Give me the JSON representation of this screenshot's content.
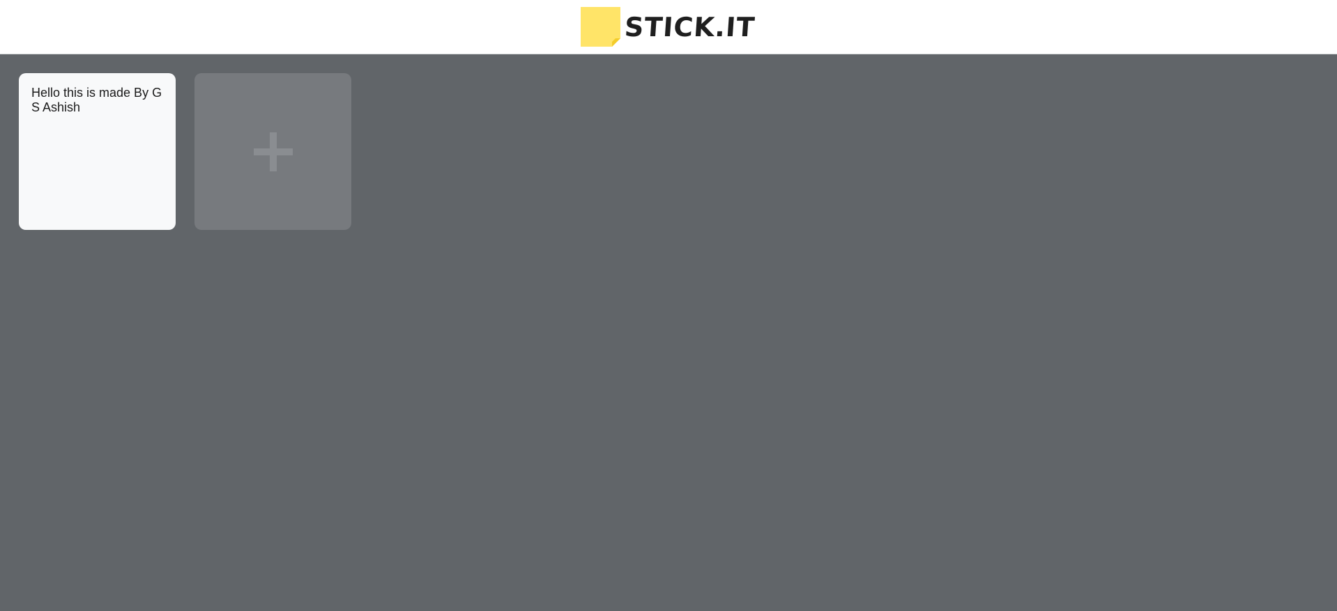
{
  "header": {
    "logo_text": "STICK.IT",
    "logo_color": "#ffe468"
  },
  "board": {
    "background": "#616569",
    "notes": [
      {
        "text": "Hello this is made By G S Ashish"
      }
    ],
    "add_button": {
      "icon": "plus-icon"
    }
  }
}
